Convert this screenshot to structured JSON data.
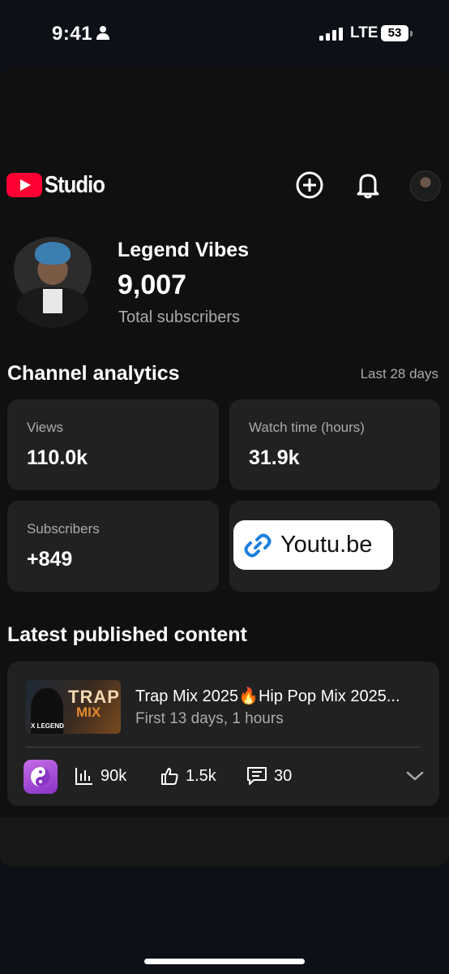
{
  "status_bar": {
    "time": "9:41",
    "network": "LTE",
    "battery": "53"
  },
  "header": {
    "logo_text": "Studio",
    "icons": [
      "add-circle-icon",
      "bell-icon",
      "account-avatar"
    ]
  },
  "channel": {
    "name": "Legend Vibes",
    "subscribers": "9,007",
    "subscribers_label": "Total subscribers"
  },
  "analytics": {
    "title": "Channel analytics",
    "period": "Last 28 days",
    "cards": [
      {
        "label": "Views",
        "value": "110.0k"
      },
      {
        "label": "Watch time (hours)",
        "value": "31.9k"
      },
      {
        "label": "Subscribers",
        "value": "+849"
      }
    ],
    "link_chip": "Youtu.be"
  },
  "latest": {
    "title": "Latest published content",
    "video": {
      "title": "Trap Mix 2025🔥Hip Pop Mix 2025...",
      "meta": "First 13 days, 1 hours",
      "thumb_text_1": "TRAP",
      "thumb_text_2": "MIX",
      "thumb_brand": "X LEGEND",
      "views": "90k",
      "likes": "1.5k",
      "comments": "30"
    }
  },
  "colors": {
    "accent_red": "#ff0033",
    "background": "#101010",
    "card": "#212121",
    "muted_text": "#aaaaaa"
  }
}
